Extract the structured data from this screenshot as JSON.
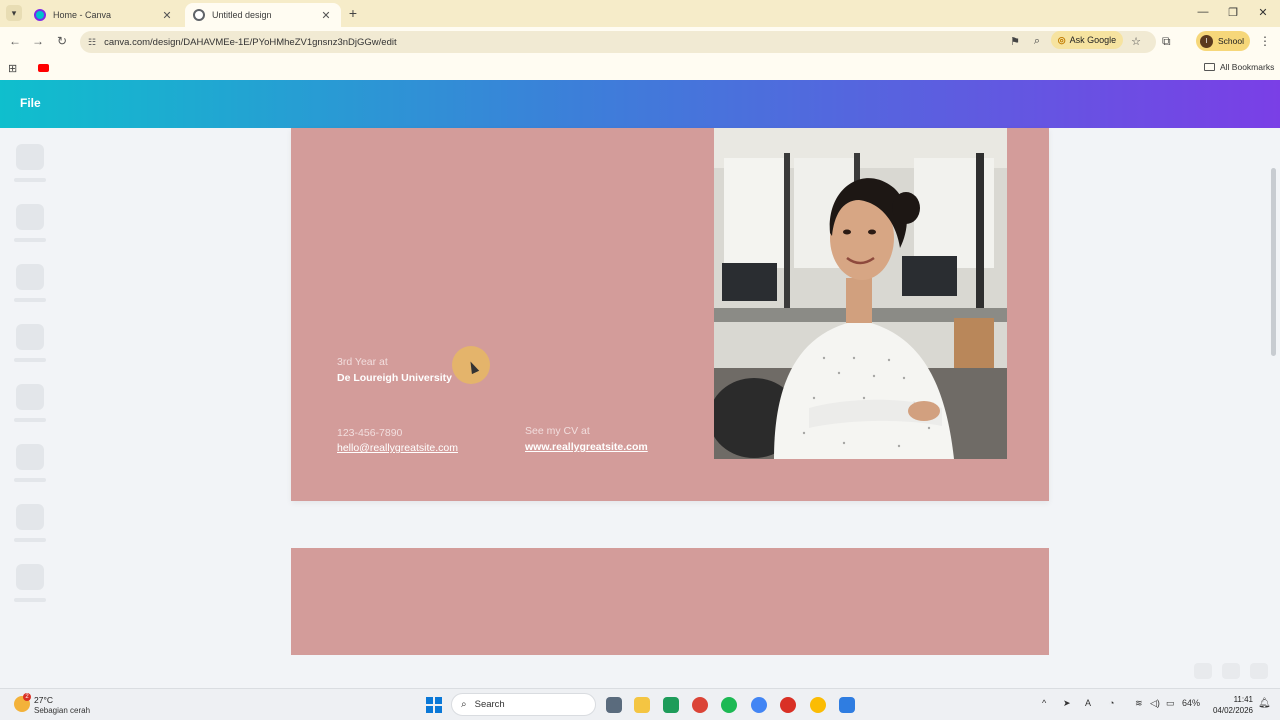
{
  "browser": {
    "tabs": [
      {
        "title": "Home - Canva",
        "active": false
      },
      {
        "title": "Untitled design",
        "active": true
      }
    ],
    "url": "canva.com/design/DAHAVMEe-1E/PYoHMheZV1gnsnz3nDjGGw/edit",
    "ask_google_label": "Ask Google",
    "profile_label": "School",
    "profile_initial": "I",
    "all_bookmarks_label": "All Bookmarks"
  },
  "canva": {
    "file_label": "File"
  },
  "design": {
    "page_color": "#d39c9a",
    "year_text": "3rd Year at",
    "university_text": "De Loureigh University",
    "phone_text": "123-456-7890",
    "email_text": "hello@reallygreatsite.com",
    "cv_label_text": "See my CV at",
    "cv_link_text": "www.reallygreatsite.com"
  },
  "taskbar": {
    "weather_temp": "27°C",
    "weather_desc": "Sebagian cerah",
    "weather_badge": "2",
    "search_label": "Search",
    "battery_percent": "64%",
    "time": "11:41",
    "date": "04/02/2026"
  },
  "colors": {
    "header_start": "#0fbfcd",
    "header_end": "#7a3fe6",
    "accent": "#f6d77a"
  }
}
